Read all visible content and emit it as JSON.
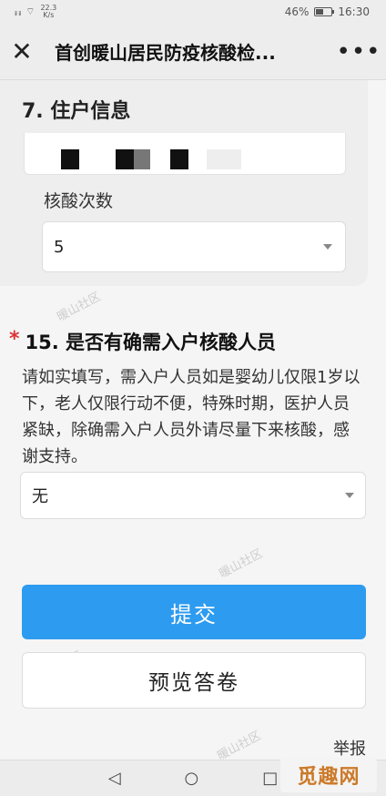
{
  "status_bar": {
    "signal": "ᵢₗ ᵢₗ",
    "speed": "22.3",
    "speed_unit": "K/s",
    "battery": "46%",
    "battery_level": 0.46,
    "time": "16:30"
  },
  "nav": {
    "close_icon": "close-icon",
    "title": "首创暖山居民防疫核酸检...",
    "more_icon": "more-icon",
    "more_glyph": "•••"
  },
  "section": {
    "title": "7. 住户信息",
    "field_label": "核酸次数",
    "field_value": "5"
  },
  "question": {
    "required_mark": "*",
    "title": "15. 是否有确需入户核酸人员",
    "description": "请如实填写，需入户人员如是婴幼儿仅限1岁以下，老人仅限行动不便，特殊时期，医护人员紧缺，除确需入户人员外请尽量下来核酸，感谢支持。",
    "answer": "无"
  },
  "buttons": {
    "submit": "提交",
    "preview": "预览答卷"
  },
  "report_link": "举报",
  "watermark": "暖山社区",
  "system_nav": {
    "back": "◁",
    "home": "○",
    "recent": "□"
  },
  "corner_logo": "觅趣网"
}
